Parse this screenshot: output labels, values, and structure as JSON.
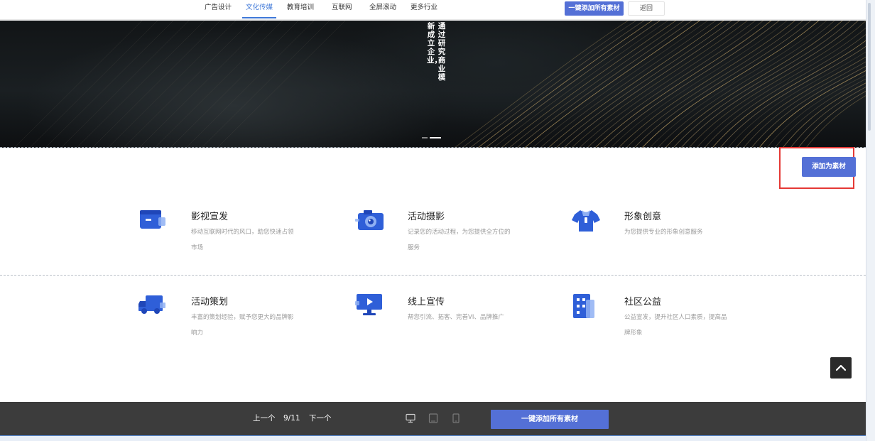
{
  "nav": {
    "items": [
      {
        "label": "广告设计",
        "active": false
      },
      {
        "label": "文化传媒",
        "active": true
      },
      {
        "label": "教育培训",
        "active": false
      },
      {
        "label": "互联网",
        "active": false
      },
      {
        "label": "全屏滚动",
        "active": false
      },
      {
        "label": "更多行业",
        "active": false
      }
    ],
    "add_all_label": "一键添加所有素材",
    "back_label": "返回"
  },
  "banner": {
    "vertical_text": [
      "通过研究商业模",
      "新成立企业，"
    ],
    "slide_count": 2,
    "active_slide": 2
  },
  "add_material_label": "添加为素材",
  "services": [
    {
      "icon": "video-wallet-icon",
      "title": "影视宣发",
      "desc": "移动互联网时代的风口，助您快速占领市场"
    },
    {
      "icon": "camera-icon",
      "title": "活动摄影",
      "desc": "记录您的活动过程，为您提供全方位的服务"
    },
    {
      "icon": "tshirt-icon",
      "title": "形象创意",
      "desc": "为您提供专业的形象创意服务"
    },
    {
      "icon": "truck-icon",
      "title": "活动策划",
      "desc": "丰富的策划经验，赋予您更大的品牌影响力"
    },
    {
      "icon": "monitor-play-icon",
      "title": "线上宣传",
      "desc": "帮您引流、拓客、完善VI、品牌推广"
    },
    {
      "icon": "building-icon",
      "title": "社区公益",
      "desc": "公益宣发，提升社区人口素质，提高品牌形象"
    }
  ],
  "bottom": {
    "prev_label": "上一个",
    "page_indicator": "9/11",
    "next_label": "下一个",
    "add_all_label": "一键添加所有素材",
    "devices": [
      "desktop-icon",
      "tablet-icon",
      "mobile-icon"
    ]
  },
  "colors": {
    "accent": "#5470d6",
    "nav_active": "#3f78d8",
    "highlight": "#e53935",
    "bottom_bar": "#3c3c3c",
    "icon_blue": "#2f5fd8"
  }
}
